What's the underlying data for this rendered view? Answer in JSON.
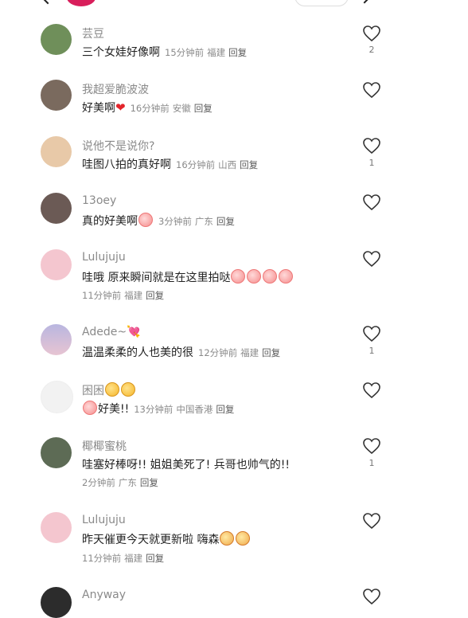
{
  "comments": [
    {
      "name": "芸豆",
      "text": "三个女娃好像啊",
      "time": "15分钟前",
      "location": "福建",
      "reply": "回复",
      "likes": "2",
      "avatar_color": "#6f8f5a",
      "emoji": []
    },
    {
      "name": "我超爱脆波波",
      "text": "好美啊",
      "time": "16分钟前",
      "location": "安徽",
      "reply": "回复",
      "likes": "",
      "avatar_color": "#7a6a5e",
      "emoji": [
        "heart-emoji"
      ]
    },
    {
      "name": "说他不是说你?",
      "text": "哇图八拍的真好啊",
      "time": "16分钟前",
      "location": "山西",
      "reply": "回复",
      "likes": "1",
      "avatar_color": "#e8c9a8",
      "emoji": []
    },
    {
      "name": "13oey",
      "text": "真的好美啊",
      "time": "3分钟前",
      "location": "广东",
      "reply": "回复",
      "likes": "",
      "avatar_color": "#6b5a55",
      "emoji": [
        "peach-emoji"
      ]
    },
    {
      "name": "Lulujuju",
      "text": "哇哦 原来瞬间就是在这里拍哒",
      "time": "11分钟前",
      "location": "福建",
      "reply": "回复",
      "likes": "",
      "avatar_color": "#f4c6cf",
      "emoji": [
        "peach-emoji",
        "peach-emoji",
        "peach-emoji",
        "peach-emoji"
      ]
    },
    {
      "name": "Adede~",
      "text": "温温柔柔的人也美的很",
      "time": "12分钟前",
      "location": "福建",
      "reply": "回复",
      "likes": "1",
      "avatar_color": "#b9b6e0",
      "emoji": [
        "heart-arrow-emoji"
      ]
    },
    {
      "name": "困困",
      "text": "好美!!",
      "time": "13分钟前",
      "location": "中国香港",
      "reply": "回复",
      "likes": "",
      "avatar_color": "#f2f2f2",
      "emoji": [
        "sad-emoji",
        "sad-emoji"
      ]
    },
    {
      "name": "椰椰蜜桃",
      "text": "哇塞好棒呀!! 姐姐美死了! 兵哥也帅气的!!",
      "time": "2分钟前",
      "location": "广东",
      "reply": "回复",
      "likes": "1",
      "avatar_color": "#5d6b55",
      "emoji": []
    },
    {
      "name": "Lulujuju",
      "text": "昨天催更今天就更新啦 嗨森",
      "time": "11分钟前",
      "location": "福建",
      "reply": "回复",
      "likes": "",
      "avatar_color": "#f4c6cf",
      "emoji": [
        "grin-emoji",
        "grin-emoji"
      ]
    },
    {
      "name": "Anyway",
      "text": "",
      "time": "",
      "location": "",
      "reply": "",
      "likes": "",
      "avatar_color": "#2c2c2c",
      "emoji": []
    }
  ],
  "colors": {
    "name": "#8a8a8a",
    "text": "#222222",
    "meta": "#8a8a8a",
    "heart_outline": "#333333"
  }
}
